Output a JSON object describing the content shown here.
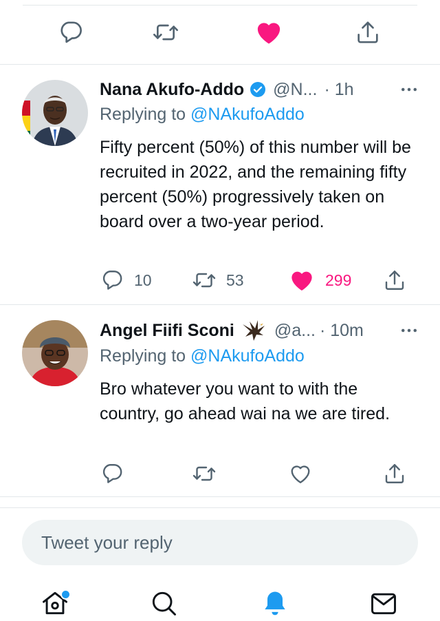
{
  "tweets": [
    {
      "name": "Nana Akufo-Addo",
      "handle": "@N...",
      "time": "· 1h",
      "verified": true,
      "replying_prefix": "Replying to",
      "replying_to": "@NAkufoAddo",
      "text": "Fifty percent (50%) of this number will be recruited in 2022, and the remaining fifty percent (50%) progressively taken on board over a two-year period.",
      "replies": "10",
      "retweets": "53",
      "likes": "299",
      "liked": true
    },
    {
      "name": "Angel Fiifi Sconi",
      "name_emoji": "eagle-emoji",
      "handle": "@a...",
      "time": "· 10m",
      "verified": false,
      "replying_prefix": "Replying to",
      "replying_to": "@NAkufoAddo",
      "text": "Bro whatever you want to with the country, go ahead wai na we are tired.",
      "replies": "",
      "retweets": "",
      "likes": "",
      "liked": false
    }
  ],
  "reply_box": {
    "placeholder": "Tweet your reply"
  },
  "top_actions": [
    "reply-icon",
    "retweet-icon",
    "like-icon-filled",
    "share-icon"
  ],
  "tabbar": [
    "home-icon",
    "search-icon",
    "notifications-icon",
    "messages-icon"
  ],
  "colors": {
    "accent": "#1d9bf0",
    "like": "#f91880",
    "muted": "#536471",
    "text": "#0f1419",
    "divider": "#e3e7ea"
  }
}
